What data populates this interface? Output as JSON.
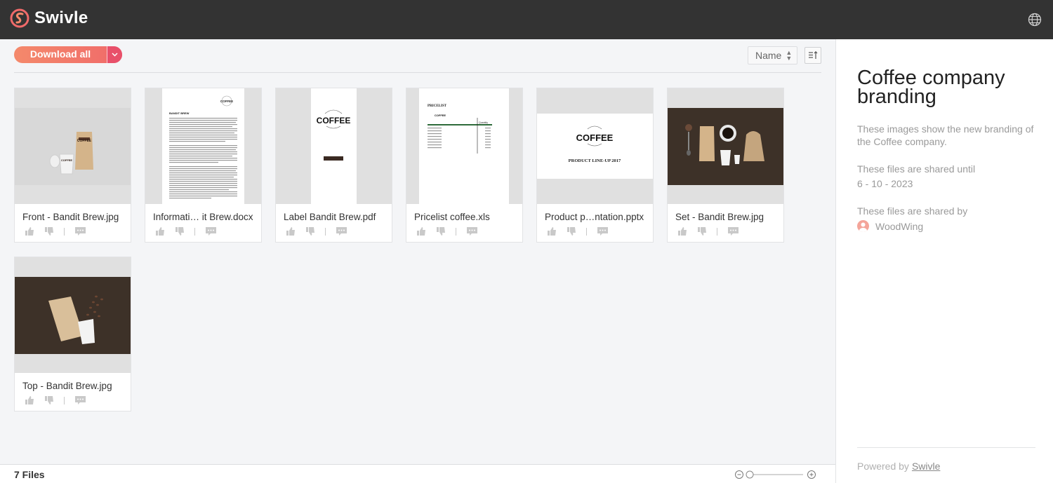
{
  "header": {
    "brand": "Swivle",
    "brand_color": "#f06a6a",
    "language_icon": "globe-icon"
  },
  "toolbar": {
    "download_all": "Download all",
    "sort_value": "Name"
  },
  "files": [
    {
      "name": "Front - Bandit Brew.jpg",
      "thumb": "photo-bag-cup-light"
    },
    {
      "name": "Informati… it Brew.docx",
      "thumb": "document-page"
    },
    {
      "name": "Label Bandit Brew.pdf",
      "thumb": "label-page"
    },
    {
      "name": "Pricelist coffee.xls",
      "thumb": "spreadsheet-page"
    },
    {
      "name": "Product p…ntation.pptx",
      "thumb": "presentation-slide"
    },
    {
      "name": "Set - Bandit Brew.jpg",
      "thumb": "photo-set-dark"
    },
    {
      "name": "Top - Bandit Brew.jpg",
      "thumb": "photo-bag-beans-dark"
    }
  ],
  "thumb_text": {
    "coffee": "COFFEE",
    "bandit_brew": "BANDIT BREW",
    "pricelist": "PRICELIST",
    "quantity": "Quantity",
    "product_lineup": "PRODUCT LINE-UP 2017"
  },
  "footer": {
    "file_count": "7 Files"
  },
  "sidebar": {
    "title": "Coffee company branding",
    "description": "These images show the new branding of the Coffee company.",
    "shared_until_label": "These files are shared until",
    "shared_until_date": "6 - 10 - 2023",
    "shared_by_label": "These files are shared by",
    "shared_by": "WoodWing",
    "powered_by": "Powered by",
    "powered_by_link": "Swivle"
  }
}
